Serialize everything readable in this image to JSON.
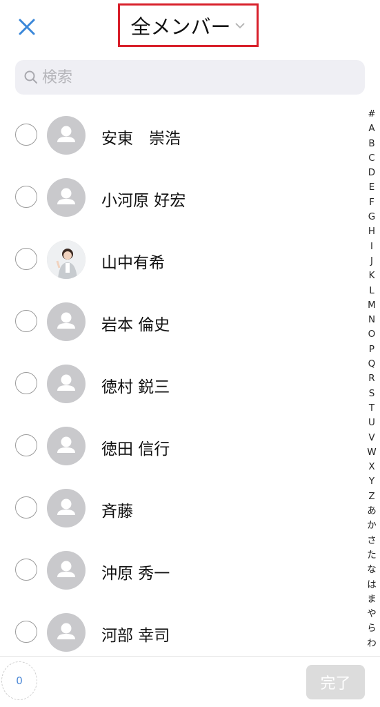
{
  "header": {
    "title": "全メンバー",
    "close_icon": "close-icon",
    "chevron_icon": "chevron-down-icon",
    "accent_color": "#3a87d9",
    "highlight_color": "#d81f2a"
  },
  "search": {
    "placeholder": "検索",
    "icon": "search-icon"
  },
  "members": [
    {
      "name": "安東　崇浩",
      "avatar": "default-avatar"
    },
    {
      "name": "小河原 好宏",
      "avatar": "default-avatar"
    },
    {
      "name": "山中有希",
      "avatar": "photo-avatar"
    },
    {
      "name": "岩本 倫史",
      "avatar": "default-avatar"
    },
    {
      "name": "徳村 鋭三",
      "avatar": "default-avatar"
    },
    {
      "name": "徳田 信行",
      "avatar": "default-avatar"
    },
    {
      "name": "斉藤",
      "avatar": "default-avatar"
    },
    {
      "name": "沖原 秀一",
      "avatar": "default-avatar"
    },
    {
      "name": "河部 幸司",
      "avatar": "default-avatar"
    }
  ],
  "index": [
    "#",
    "A",
    "B",
    "C",
    "D",
    "E",
    "F",
    "G",
    "H",
    "I",
    "J",
    "K",
    "L",
    "M",
    "N",
    "O",
    "P",
    "Q",
    "R",
    "S",
    "T",
    "U",
    "V",
    "W",
    "X",
    "Y",
    "Z",
    "あ",
    "か",
    "さ",
    "た",
    "な",
    "は",
    "ま",
    "や",
    "ら",
    "わ"
  ],
  "footer": {
    "selected_count": "0",
    "done_label": "完了"
  }
}
